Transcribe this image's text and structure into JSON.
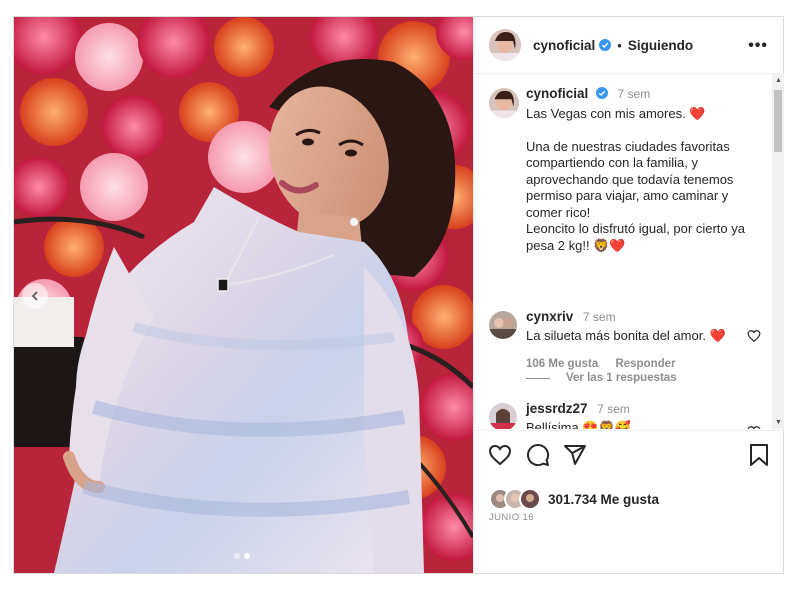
{
  "post": {
    "author": "cynoficial",
    "follow_separator": "•",
    "follow_label": "Siguiendo",
    "more_label": "•••"
  },
  "caption": {
    "author": "cynoficial",
    "time": "7 sem",
    "line1": "Las Vegas con mis amores. ❤️",
    "body": "Una de nuestras ciudades favoritas compartiendo con la familia, y aprovechando que todavía tenemos permiso para viajar, amo caminar y comer rico!",
    "body2": "Leoncito lo disfrutó igual, por cierto ya pesa 2 kg!! 🦁❤️"
  },
  "comments": [
    {
      "author": "cynxriv",
      "time": "7 sem",
      "text": "La silueta más bonita del amor. ❤️",
      "likes": "106 Me gusta",
      "reply": "Responder",
      "view_replies": "Ver las 1 respuestas"
    },
    {
      "author": "jessrdz27",
      "time": "7 sem",
      "text": "Bellísima 😍🦁🥰"
    }
  ],
  "likes_count": "301.734 Me gusta",
  "date": "JUNIO 16",
  "colors": {
    "verified": "#3897f0",
    "heart": "#ed4956",
    "text": "#262626",
    "muted": "#8e8e8e"
  },
  "icons": [
    "chevron-left-icon",
    "more-icon",
    "heart-icon",
    "comment-icon",
    "share-icon",
    "bookmark-icon",
    "verified-icon"
  ]
}
